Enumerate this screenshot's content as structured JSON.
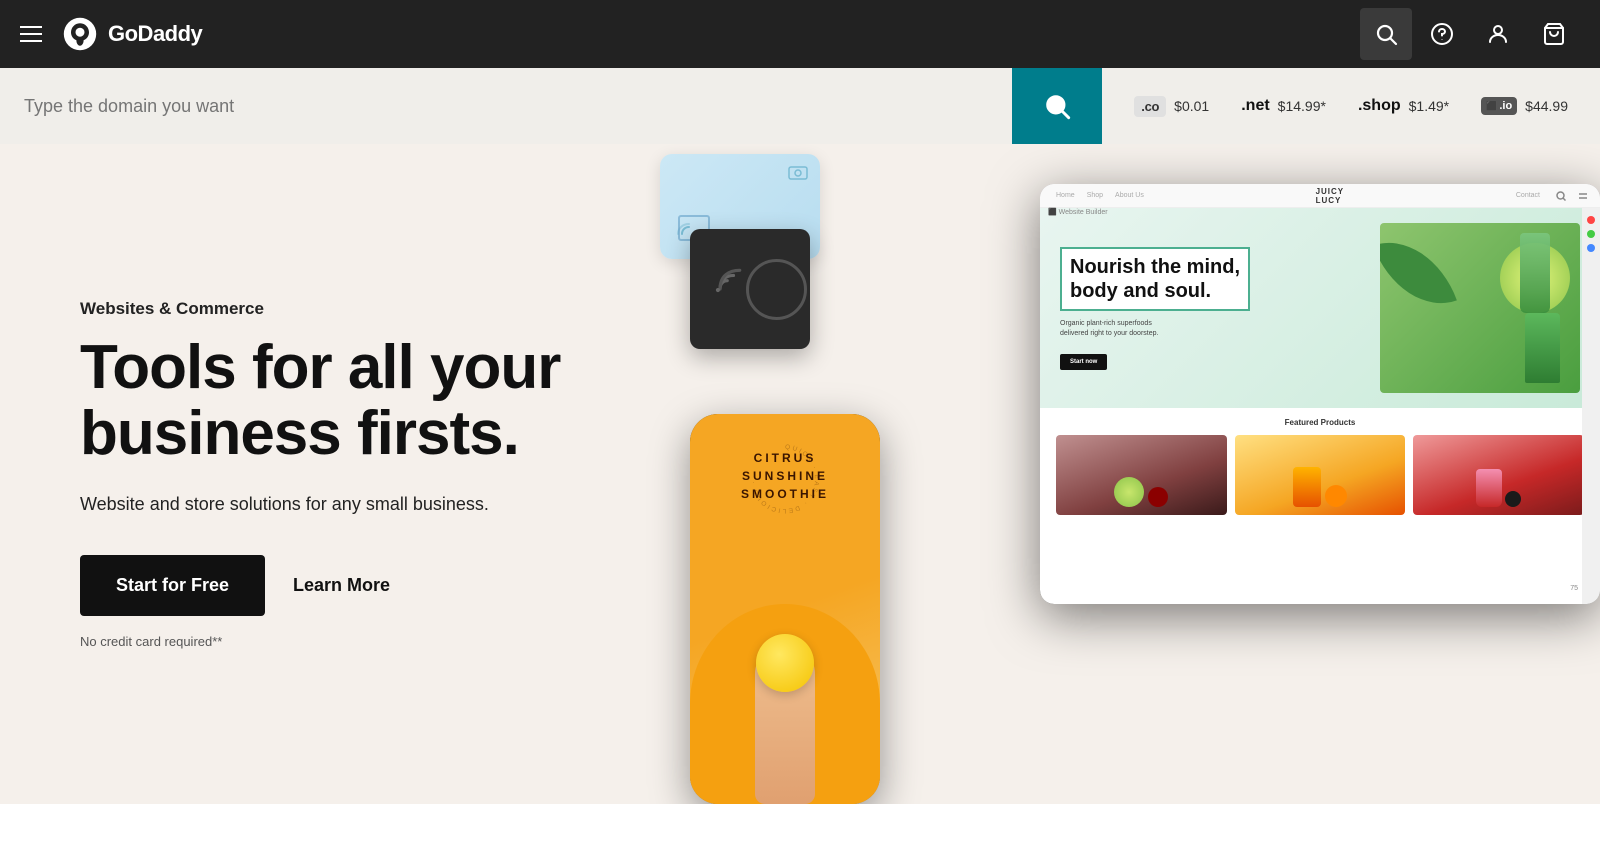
{
  "navbar": {
    "logo_text": "GoDaddy",
    "search_label": "Search",
    "help_label": "Help",
    "account_label": "Account",
    "cart_label": "Cart"
  },
  "domain_bar": {
    "input_placeholder": "Type the domain you want",
    "search_button_label": "Search",
    "tlds": [
      {
        "ext": ".co",
        "price": "$0.01",
        "badge": ".co"
      },
      {
        "ext": ".net",
        "price": "$14.99*"
      },
      {
        "ext": ".shop",
        "price": "$1.49*"
      },
      {
        "ext": ".io",
        "price": "$44.99"
      }
    ]
  },
  "hero": {
    "category": "Websites & Commerce",
    "headline": "Tools for all your\nbusiness firsts.",
    "subtext": "Website and store solutions for any small business.",
    "cta_primary": "Start for Free",
    "cta_secondary": "Learn More",
    "disclaimer": "No credit card required**"
  },
  "tablet_mockup": {
    "brand": "JUICY\nLUCY",
    "hero_title": "Nourish the mind,\nbody and soul.",
    "hero_sub": "Organic plant-rich superfoods\ndelivered right to your doorstep.",
    "hero_btn": "Start now",
    "products_title": "Featured Products",
    "nav_items": [
      "Home",
      "Shop",
      "About Us",
      "Contact"
    ]
  },
  "phone_mockup": {
    "label": "CITRUS\nSUNSHINE\nSMOOTHIE"
  }
}
